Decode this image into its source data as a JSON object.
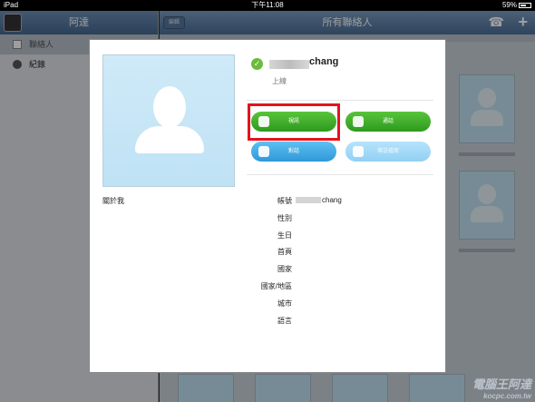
{
  "status_bar": {
    "device": "iPad",
    "time": "下午11:08",
    "battery": "59%"
  },
  "sidebar": {
    "title": "阿達",
    "items": [
      {
        "label": "聯絡人",
        "selected": true,
        "icon": "person-icon"
      },
      {
        "label": "紀錄",
        "selected": false,
        "icon": "clock-icon"
      }
    ]
  },
  "main": {
    "title": "所有聯絡人",
    "back_label": "編輯",
    "icons": [
      "phone-icon",
      "plus-icon"
    ]
  },
  "profile": {
    "name": "chang",
    "status": "上線",
    "about_label": "關於我",
    "buttons": {
      "video": "視訊",
      "call": "通話",
      "chat": "對話",
      "send_file": "傳送檔案"
    },
    "fields": [
      {
        "label": "帳號",
        "value": "chang"
      },
      {
        "label": "性別",
        "value": ""
      },
      {
        "label": "生日",
        "value": ""
      },
      {
        "label": "首頁",
        "value": ""
      },
      {
        "label": "國家",
        "value": ""
      },
      {
        "label": "國家/地區",
        "value": ""
      },
      {
        "label": "城市",
        "value": ""
      },
      {
        "label": "語言",
        "value": ""
      }
    ]
  },
  "colors": {
    "online": "#6cbb3c",
    "green_button": "#3aa826",
    "blue_button": "#3aa5e3",
    "highlight": "#e2141e"
  },
  "watermark": {
    "line1": "電腦王阿達",
    "line2": "kocpc.com.tw"
  }
}
